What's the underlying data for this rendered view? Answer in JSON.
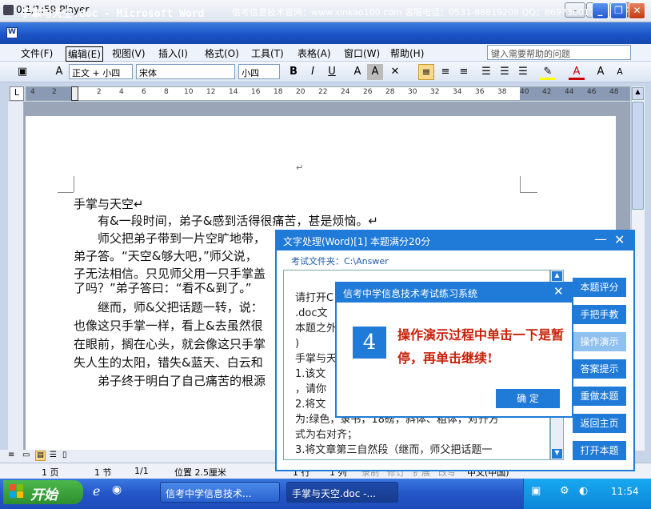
{
  "player": {
    "title": "0:1/1:59 Player"
  },
  "word": {
    "title": "手掌与天空.doc - Microsoft Word",
    "ad": "信考信息技术官网：www.xinkao100.com 客服电话：0531-88819208 QQ：869730011",
    "menus": [
      "文件(F)",
      "编辑(E)",
      "视图(V)",
      "插入(I)",
      "格式(O)",
      "工具(T)",
      "表格(A)",
      "窗口(W)",
      "帮助(H)"
    ],
    "help_placeholder": "键入需要帮助的问题",
    "style": "正文 + 小四",
    "font": "宋体",
    "size": "小四",
    "ruler_nums": [
      "4",
      "2",
      "2",
      "4",
      "6",
      "8",
      "10",
      "12",
      "14",
      "16",
      "18",
      "20",
      "22",
      "24",
      "26",
      "28",
      "30",
      "32",
      "34",
      "36",
      "38",
      "40",
      "42",
      "44",
      "46",
      "48"
    ]
  },
  "document": {
    "lines": [
      "手掌与天空↵",
      "　　有&一段时间，弟子&感到活得很痛苦，甚是烦恼。↵",
      "　　师父把弟子带到一片空旷地带，",
      "弟子答。“天空&够大吧，”师父说，",
      "子无法相信。只见师父用一只手掌盖",
      "了吗？”弟子答曰：“看不&到了。”",
      "　　继而，师&父把话题一转，说：",
      "也像这只手掌一样，看上&去虽然很",
      "在眼前，搁在心头，就会像这只手掌",
      "失人生的太阳，错失&蓝天、白云和",
      "　　弟子终于明白了自己痛苦的根源"
    ]
  },
  "status": {
    "page": "1 页",
    "section": "1 节",
    "count": "1/1",
    "position": "位置 2.5厘米",
    "line": "1 行",
    "col": "1 列",
    "rec": "录制",
    "trk": "修订",
    "ext": "扩展",
    "ovr": "改写",
    "lang": "中文(中国)"
  },
  "exam": {
    "header": "文字处理(Word)[1]  本题满分20分",
    "folder": "考试文件夹：C:\\Answer",
    "text_lines": [
      "请打开C",
      ".doc文",
      "本题之外",
      ")",
      "手掌与天",
      "1.该文",
      "，请你",
      "2.将文",
      "为:绿色，隶书，18磅，斜体、粗体，对齐方",
      "式为右对齐；",
      "3.将文章第三自然段（继而，师父把话题一"
    ],
    "side_buttons": [
      "本题评分",
      "手把手教",
      "操作演示",
      "答案提示",
      "重做本题",
      "返回主页",
      "打开本题"
    ]
  },
  "dialog": {
    "title": "信考中学信息技术考试练习系统",
    "step": "4",
    "message": "操作演示过程中单击一下是暂停，再单击继续!",
    "ok": "确  定"
  },
  "taskbar": {
    "start": "开始",
    "tasks": [
      "信考中学信息技术...",
      "手掌与天空.doc -..."
    ],
    "clock": "11:54"
  }
}
